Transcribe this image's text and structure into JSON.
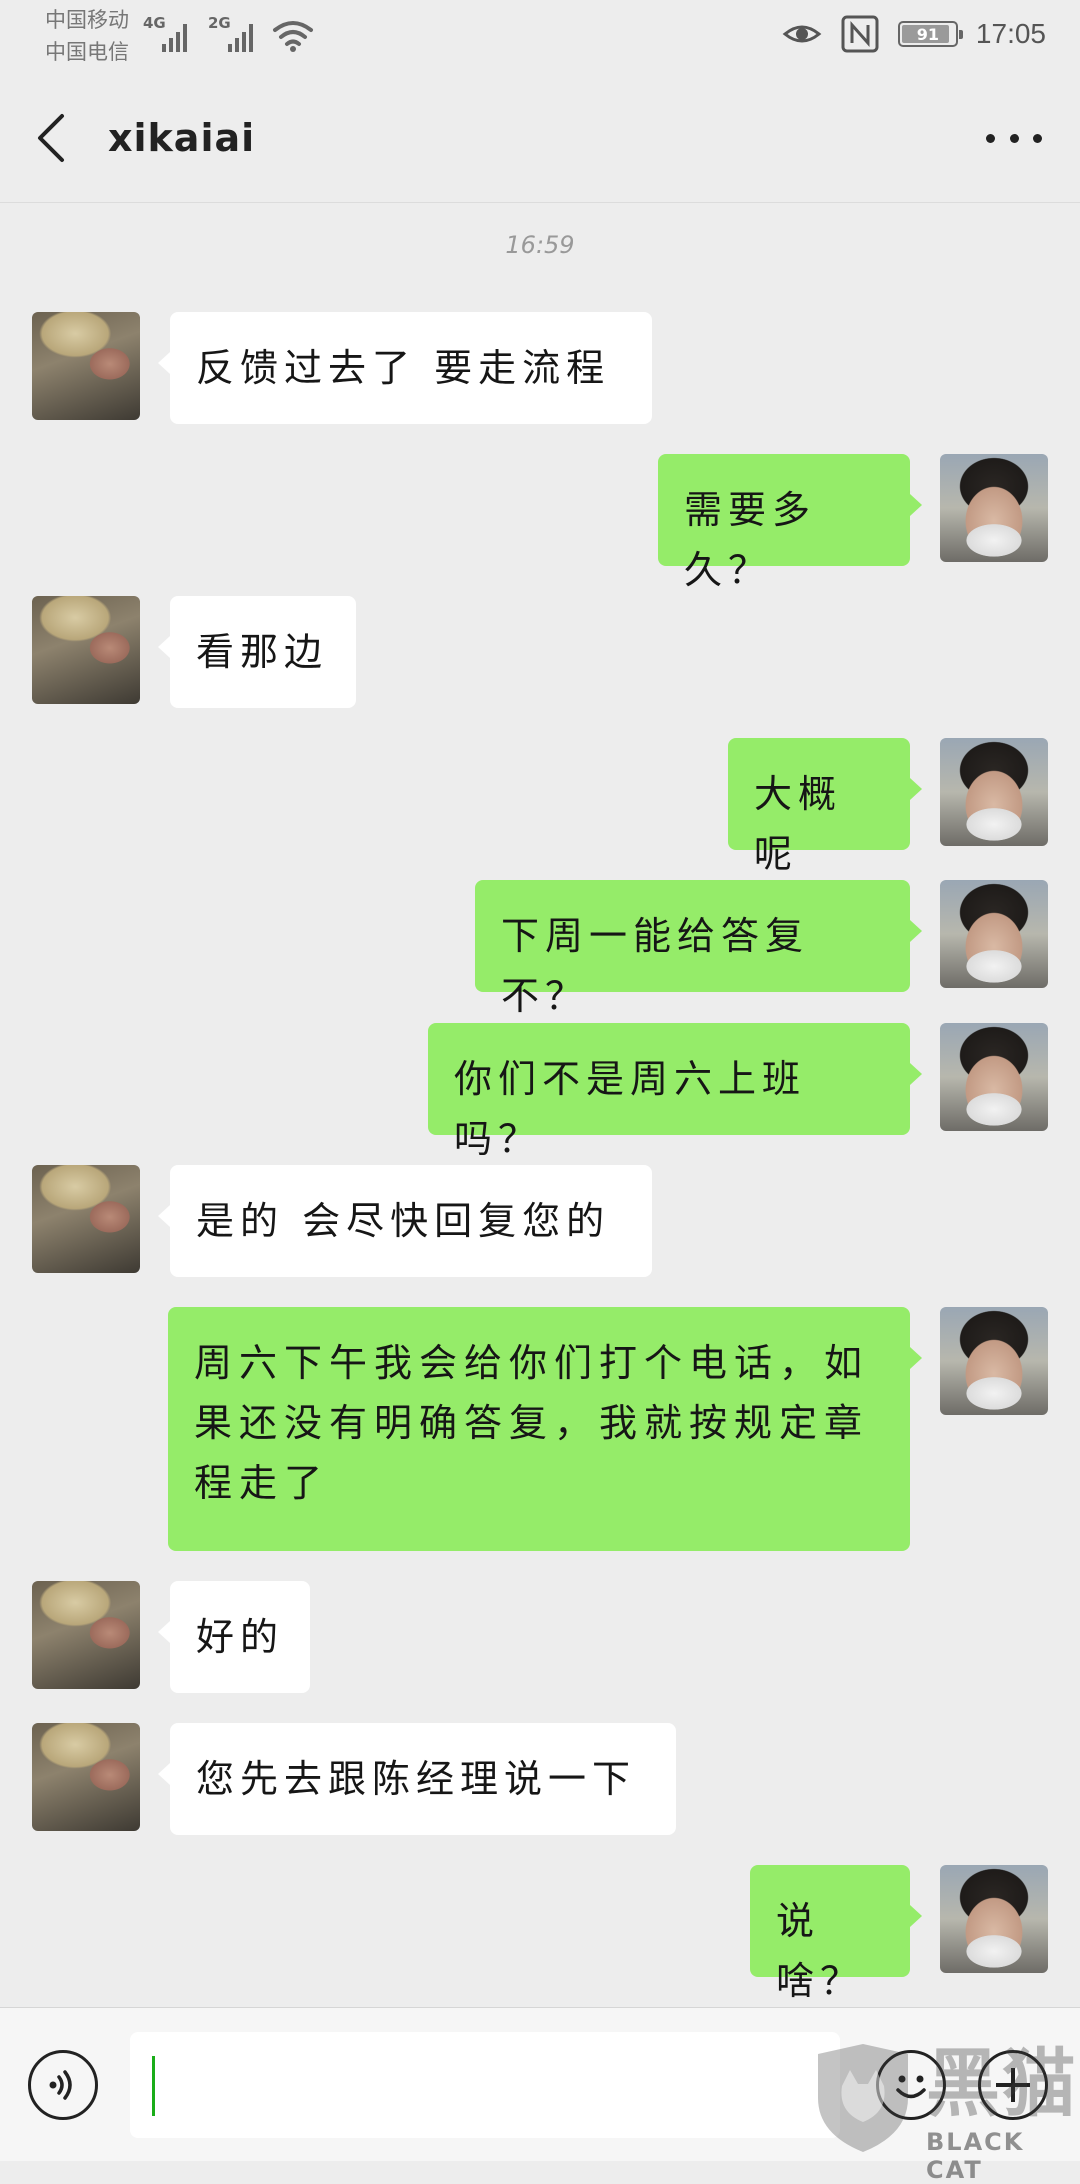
{
  "status_bar": {
    "carrier_1": "中国移动",
    "carrier_2": "中国电信",
    "net_1": "4G",
    "net_2": "2G",
    "battery": "91",
    "battery_level": 0.91,
    "time": "17:05",
    "icons": [
      "signal-icon",
      "wifi-icon",
      "eye-icon",
      "nfc-icon",
      "battery-icon"
    ]
  },
  "header": {
    "title": "xikaiai",
    "back_icon": "back-arrow-icon",
    "more_icon": "more-icon"
  },
  "messages": {
    "timestamp": "16:59",
    "items": [
      {
        "side": "left",
        "text": "反馈过去了 要走流程"
      },
      {
        "side": "right",
        "text": "需要多久？"
      },
      {
        "side": "left",
        "text": "看那边"
      },
      {
        "side": "right",
        "text": "大概呢"
      },
      {
        "side": "right",
        "text": "下周一能给答复不？"
      },
      {
        "side": "right",
        "text": "你们不是周六上班吗？"
      },
      {
        "side": "left",
        "text": "是的 会尽快回复您的"
      },
      {
        "side": "right",
        "text": "周六下午我会给你们打个电话，如果还没有明确答复，我就按规定章程走了"
      },
      {
        "side": "left",
        "text": "好的"
      },
      {
        "side": "left",
        "text": "您先去跟陈经理说一下"
      },
      {
        "side": "right",
        "text": "说啥？"
      }
    ]
  },
  "input_bar": {
    "value": "",
    "icons": [
      "voice-icon",
      "emoji-icon",
      "plus-icon"
    ]
  },
  "watermark": {
    "brand": "黑猫",
    "subtitle": "BLACK CAT"
  },
  "colors": {
    "background": "#ededed",
    "bubble_self": "#95ec69",
    "bubble_other": "#ffffff",
    "cursor": "#1aad19"
  }
}
